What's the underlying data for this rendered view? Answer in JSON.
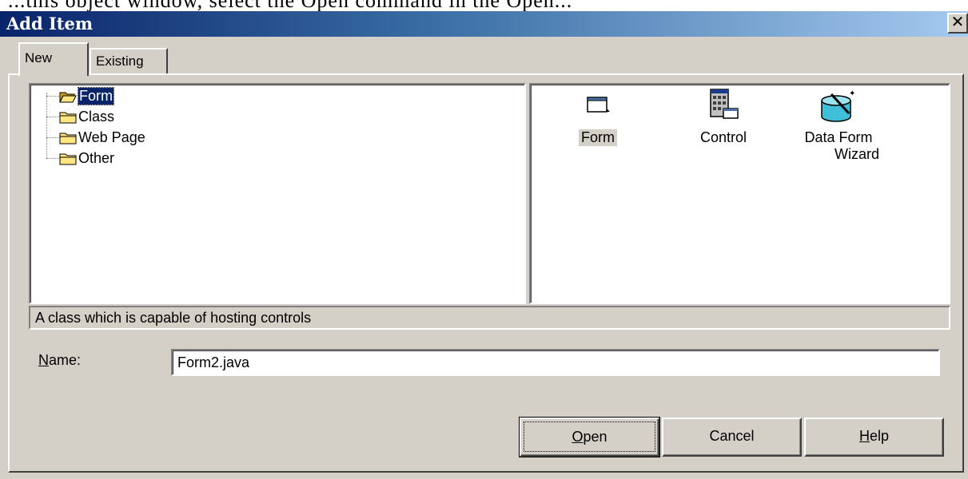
{
  "background": {
    "text": "...this object window, select the Open command in the Open..."
  },
  "window": {
    "title": "Add Item",
    "close_glyph": "✕"
  },
  "tabs": [
    {
      "label": "New",
      "active": true
    },
    {
      "label": "Existing",
      "active": false
    }
  ],
  "tree": {
    "items": [
      {
        "label": "Form",
        "icon": "open-folder-icon",
        "selected": true
      },
      {
        "label": "Class",
        "icon": "folder-icon",
        "selected": false
      },
      {
        "label": "Web Page",
        "icon": "folder-icon",
        "selected": false
      },
      {
        "label": "Other",
        "icon": "folder-icon",
        "selected": false
      }
    ]
  },
  "templates": {
    "items": [
      {
        "label": "Form",
        "icon": "form-icon",
        "selected": true
      },
      {
        "label": "Control",
        "icon": "control-icon",
        "selected": false
      },
      {
        "label": "Data Form Wizard",
        "line1": "Data Form",
        "line2": "Wizard",
        "icon": "data-form-wizard-icon",
        "selected": false
      }
    ]
  },
  "description": "A class which is capable of hosting controls",
  "name_field": {
    "label_prefix": "",
    "label_accel": "N",
    "label_rest": "ame:",
    "value": "Form2.java"
  },
  "buttons": {
    "open": {
      "accel": "O",
      "rest": "pen"
    },
    "cancel": {
      "label": "Cancel"
    },
    "help": {
      "accel": "H",
      "rest": "elp"
    }
  },
  "colors": {
    "title_gradient_start": "#0a246a",
    "title_gradient_end": "#a6caf0",
    "face": "#d4d0c8",
    "selection": "#0a246a"
  }
}
